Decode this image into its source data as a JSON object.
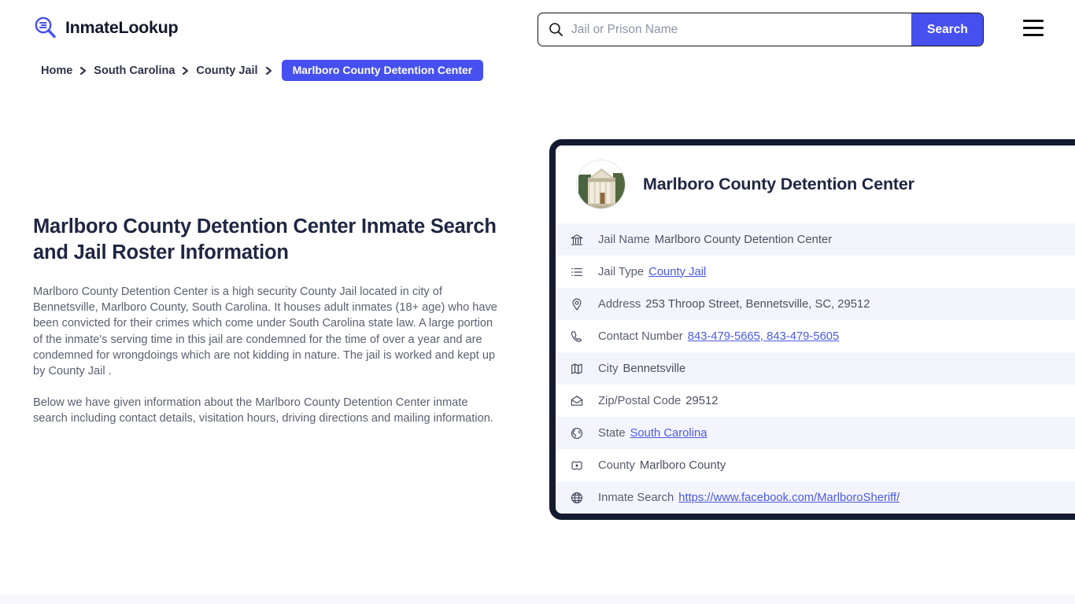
{
  "header": {
    "brand_name": "InmateLookup",
    "brand_icon": "search-list-logo-icon",
    "menu_icon": "hamburger-menu-icon",
    "search": {
      "icon": "search-icon",
      "placeholder": "Jail or Prison Name",
      "value": "",
      "button_label": "Search"
    }
  },
  "breadcrumb": {
    "items": [
      {
        "label": "Home",
        "current": false
      },
      {
        "label": "South Carolina",
        "current": false
      },
      {
        "label": "County Jail",
        "current": false
      },
      {
        "label": "Marlboro County Detention Center",
        "current": true
      }
    ],
    "separator_icon": "chevron-right-icon"
  },
  "main": {
    "title": "Marlboro County Detention Center Inmate Search and Jail Roster Information",
    "paragraphs": [
      "Marlboro County Detention Center is a high security County Jail located in city of Bennetsville, Marlboro County, South Carolina. It houses adult inmates (18+ age) who have been convicted for their crimes which come under South Carolina state law. A large portion of the inmate's serving time in this jail are condemned for the time of over a year and are condemned for wrongdoings which are not kidding in nature. The jail is worked and kept up by County Jail .",
      "Below we have given information about the Marlboro County Detention Center inmate search including contact details, visitation hours, driving directions and mailing information."
    ]
  },
  "card": {
    "thumbnail_icon": "courthouse-photo",
    "title": "Marlboro County Detention Center",
    "rows": [
      {
        "icon": "bank-building-icon",
        "label": "Jail Name",
        "value": "Marlboro County Detention Center",
        "link": false
      },
      {
        "icon": "list-icon",
        "label": "Jail Type",
        "value": "County Jail",
        "link": true
      },
      {
        "icon": "map-pin-icon",
        "label": "Address",
        "value": "253 Throop Street, Bennetsville, SC, 29512",
        "link": false
      },
      {
        "icon": "phone-icon",
        "label": "Contact Number",
        "value": "843-479-5665, 843-479-5605",
        "link": true
      },
      {
        "icon": "map-icon",
        "label": "City",
        "value": "Bennetsville",
        "link": false
      },
      {
        "icon": "envelope-icon",
        "label": "Zip/Postal Code",
        "value": "29512",
        "link": false
      },
      {
        "icon": "globe-americas-icon",
        "label": "State",
        "value": "South Carolina",
        "link": true
      },
      {
        "icon": "county-badge-icon",
        "label": "County",
        "value": "Marlboro County",
        "link": false
      },
      {
        "icon": "globe-icon",
        "label": "Inmate Search",
        "value": "https://www.facebook.com/MarlboroSheriff/",
        "link": true
      }
    ]
  },
  "colors": {
    "accent": "#4650ef",
    "card_border": "#141a30",
    "heading": "#1f2642",
    "body_text": "#5b6070",
    "link": "#4a5ae0",
    "row_alt_bg": "#f4f5fc"
  }
}
